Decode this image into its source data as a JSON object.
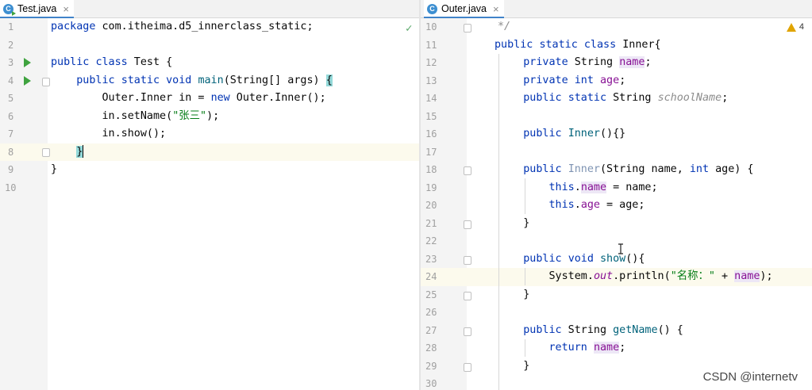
{
  "left_editor": {
    "tab": {
      "label": "Test.java",
      "icon": "java-class-runnable-icon",
      "close": "×"
    },
    "status_icon": "check-icon",
    "status_glyph": "✓",
    "line_numbers": [
      "1",
      "2",
      "3",
      "4",
      "5",
      "6",
      "7",
      "8",
      "9",
      "10"
    ],
    "code": {
      "l1": {
        "kw": "package",
        "rest": " com.itheima.d5_innerclass_static;"
      },
      "l3": {
        "kw1": "public",
        "kw2": "class",
        "rest": " Test {"
      },
      "l4": {
        "kw1": "public",
        "kw2": "static",
        "kw3": "void",
        "fn": "main",
        "rest": "(String[] args) ",
        "brace": "{"
      },
      "l5": {
        "a": "Outer.Inner in = ",
        "kw": "new",
        "b": " Outer.Inner();"
      },
      "l6": {
        "a": "in.setName(",
        "str": "\"张三\"",
        "b": ");"
      },
      "l7": {
        "a": "in.show();"
      },
      "l8": {
        "brace": "}"
      },
      "l9": {
        "a": "}"
      }
    }
  },
  "right_editor": {
    "tab": {
      "label": "Outer.java",
      "icon": "java-class-icon",
      "close": "×"
    },
    "warnings": {
      "icon": "warning-icon",
      "count": "4"
    },
    "line_numbers": [
      "10",
      "11",
      "12",
      "13",
      "14",
      "15",
      "16",
      "17",
      "18",
      "19",
      "20",
      "21",
      "22",
      "23",
      "24",
      "25",
      "26",
      "27",
      "28",
      "29",
      "30"
    ],
    "code": {
      "l10": {
        "comment": "*/"
      },
      "l11": {
        "kw1": "public",
        "kw2": "static",
        "kw3": "class",
        "rest": " Inner{"
      },
      "l12": {
        "kw": "private",
        "a": " String ",
        "field": "name",
        "b": ";"
      },
      "l13": {
        "kw1": "private",
        "kw2": "int",
        "field": "age",
        "b": ";"
      },
      "l14": {
        "kw1": "public",
        "kw2": "static",
        "a": " String ",
        "field": "schoolName",
        "b": ";"
      },
      "l16": {
        "kw": "public",
        "fn": "Inner",
        "b": "(){}"
      },
      "l18": {
        "kw": "public",
        "fn": "Inner",
        "a": "(String name, ",
        "kw2": "int",
        "b": " age) {"
      },
      "l19": {
        "kw": "this",
        "dot": ".",
        "field": "name",
        "b": " = name;"
      },
      "l20": {
        "kw": "this",
        "dot": ".",
        "field": "age",
        "b": " = age;"
      },
      "l21": {
        "a": "}"
      },
      "l23": {
        "kw1": "public",
        "kw2": "void",
        "fn": "show",
        "b": "(){"
      },
      "l24": {
        "a": "System.",
        "field": "out",
        "b": ".println(",
        "str": "\"名称：\"",
        "c": " + ",
        "field2": "name",
        "d": ");"
      },
      "l25": {
        "a": "}"
      },
      "l27": {
        "kw": "public",
        "a": " String ",
        "fn": "getName",
        "b": "() {"
      },
      "l28": {
        "kw": "return",
        "field": "name",
        "b": ";"
      },
      "l29": {
        "a": "}"
      }
    }
  },
  "watermark": "CSDN @internetv",
  "colors": {
    "keyword": "#0033b3",
    "string": "#067d17",
    "field": "#871094",
    "method": "#00627a",
    "accent": "#4083c9"
  }
}
